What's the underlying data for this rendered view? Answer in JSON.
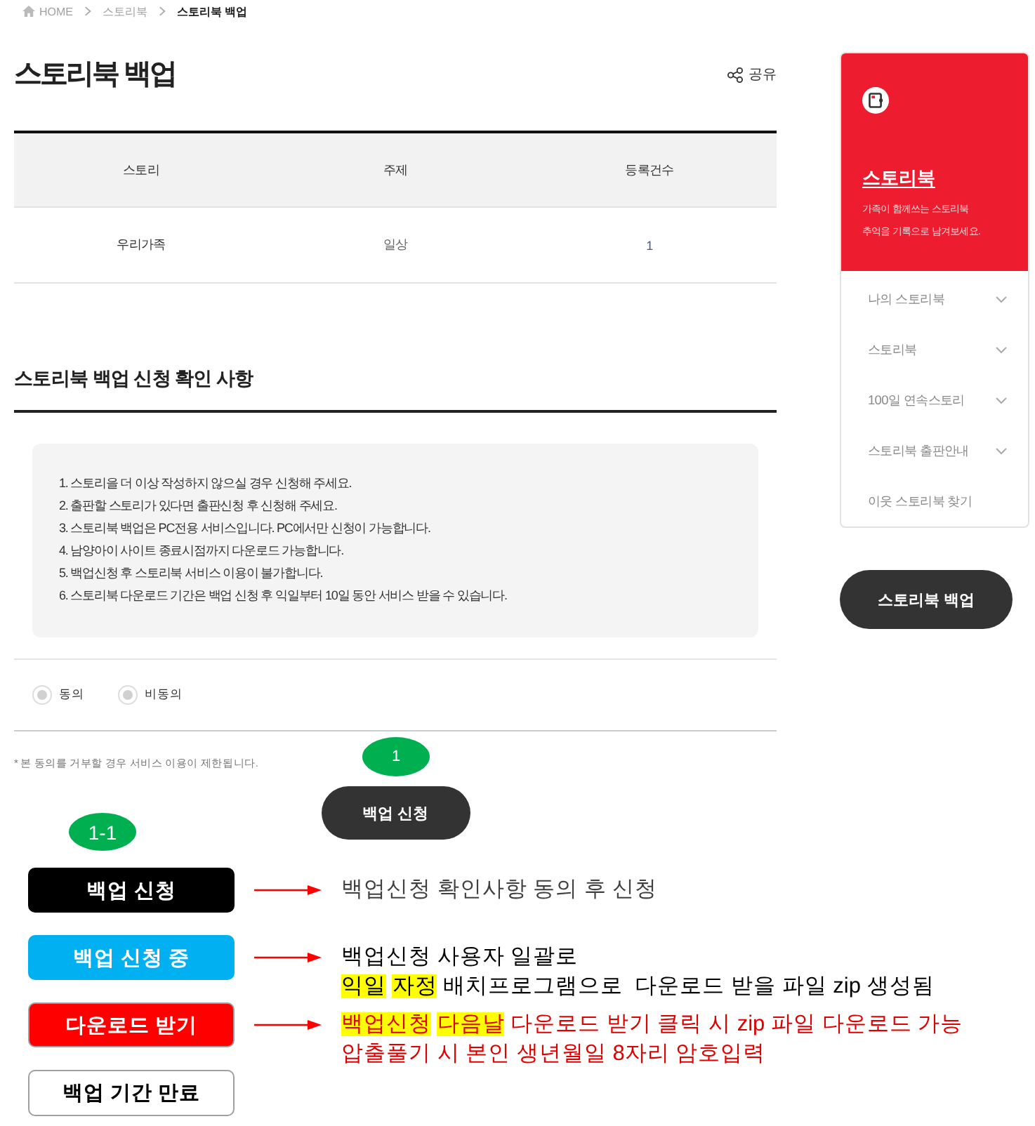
{
  "breadcrumb": [
    {
      "label": "HOME",
      "kind": "home"
    },
    {
      "label": "스토리북",
      "kind": "link"
    },
    {
      "label": "스토리북 백업",
      "kind": "current"
    }
  ],
  "title": "스토리북 백업",
  "share": {
    "label": "공유"
  },
  "table": {
    "columns": [
      "스토리",
      "주제",
      "등록건수"
    ],
    "rows": [
      [
        "우리가족",
        "일상",
        "1"
      ]
    ]
  },
  "notice": {
    "heading": "스토리북 백업 신청 확인 사항",
    "items": [
      "1. 스토리을 더 이상 작성하지 않으실 경우 신청해 주세요.",
      "2. 출판할 스토리가 있다면 출판신청 후 신청해 주세요.",
      "3. 스토리북 백업은 PC전용 서비스입니다. PC에서만 신청이 가능합니다.",
      "4. 남양아이 사이트 종료시점까지 다운로드 가능합니다.",
      "5. 백업신청 후 스토리북 서비스 이용이 불가합니다.",
      "6. 스토리북 다운로드 기간은 백업 신청 후 익일부터 10일 동안 서비스 받을 수 있습니다."
    ]
  },
  "consent": {
    "options": [
      {
        "label": "동의",
        "selected": false
      },
      {
        "label": "비동의",
        "selected": false
      }
    ],
    "note": "* 본 동의를 거부할 경우 서비스 이용이 제한됩니다."
  },
  "apply_button": {
    "label": "백업 신청",
    "badge": "1"
  },
  "sidebar": {
    "title": "스토리북",
    "tagline_lines": [
      "가족이 함께쓰는 스토리북",
      "추억을 기록으로 남겨보세요."
    ],
    "menu": [
      {
        "label": "나의 스토리북",
        "expandable": true
      },
      {
        "label": "스토리북",
        "expandable": true
      },
      {
        "label": "100일 연속스토리",
        "expandable": true
      },
      {
        "label": "스토리북 출판안내",
        "expandable": true
      },
      {
        "label": "이웃 스토리북 찾기",
        "expandable": false
      }
    ],
    "button": "스토리북 백업"
  },
  "legend": {
    "badge": "1-1",
    "rows": [
      {
        "kind": "apply",
        "label": "백업 신청",
        "lines": [
          {
            "segments": [
              {
                "text": "백업신청 확인사항 동의 후 신청",
                "highlighted": false
              }
            ]
          }
        ]
      },
      {
        "kind": "in_progress",
        "label": "백업 신청 중",
        "lines": [
          {
            "segments": [
              {
                "text": "백업신청 사용자 일괄로",
                "highlighted": false
              }
            ]
          },
          {
            "segments": [
              {
                "text": "익일 ",
                "highlighted": true
              },
              {
                "text": "자정",
                "highlighted": true
              },
              {
                "text": " 배치프로그램으로  다운로드 받을 파일 zip 생성됨",
                "highlighted": false
              }
            ]
          }
        ]
      },
      {
        "kind": "download",
        "label": "다운로드 받기",
        "lines": [
          {
            "segments": [
              {
                "text": "백업신청 ",
                "highlighted": true
              },
              {
                "text": "다음날",
                "highlighted": true
              },
              {
                "text": " 다운로드 받기 클릭 시 zip 파일 다운로드 가능",
                "highlighted": false
              }
            ]
          },
          {
            "segments": [
              {
                "text": "압출풀기 시 본인 생년월일 8자리 암호입력",
                "highlighted": false
              }
            ]
          }
        ]
      },
      {
        "kind": "expired",
        "label": "백업 기간 만료"
      }
    ]
  }
}
